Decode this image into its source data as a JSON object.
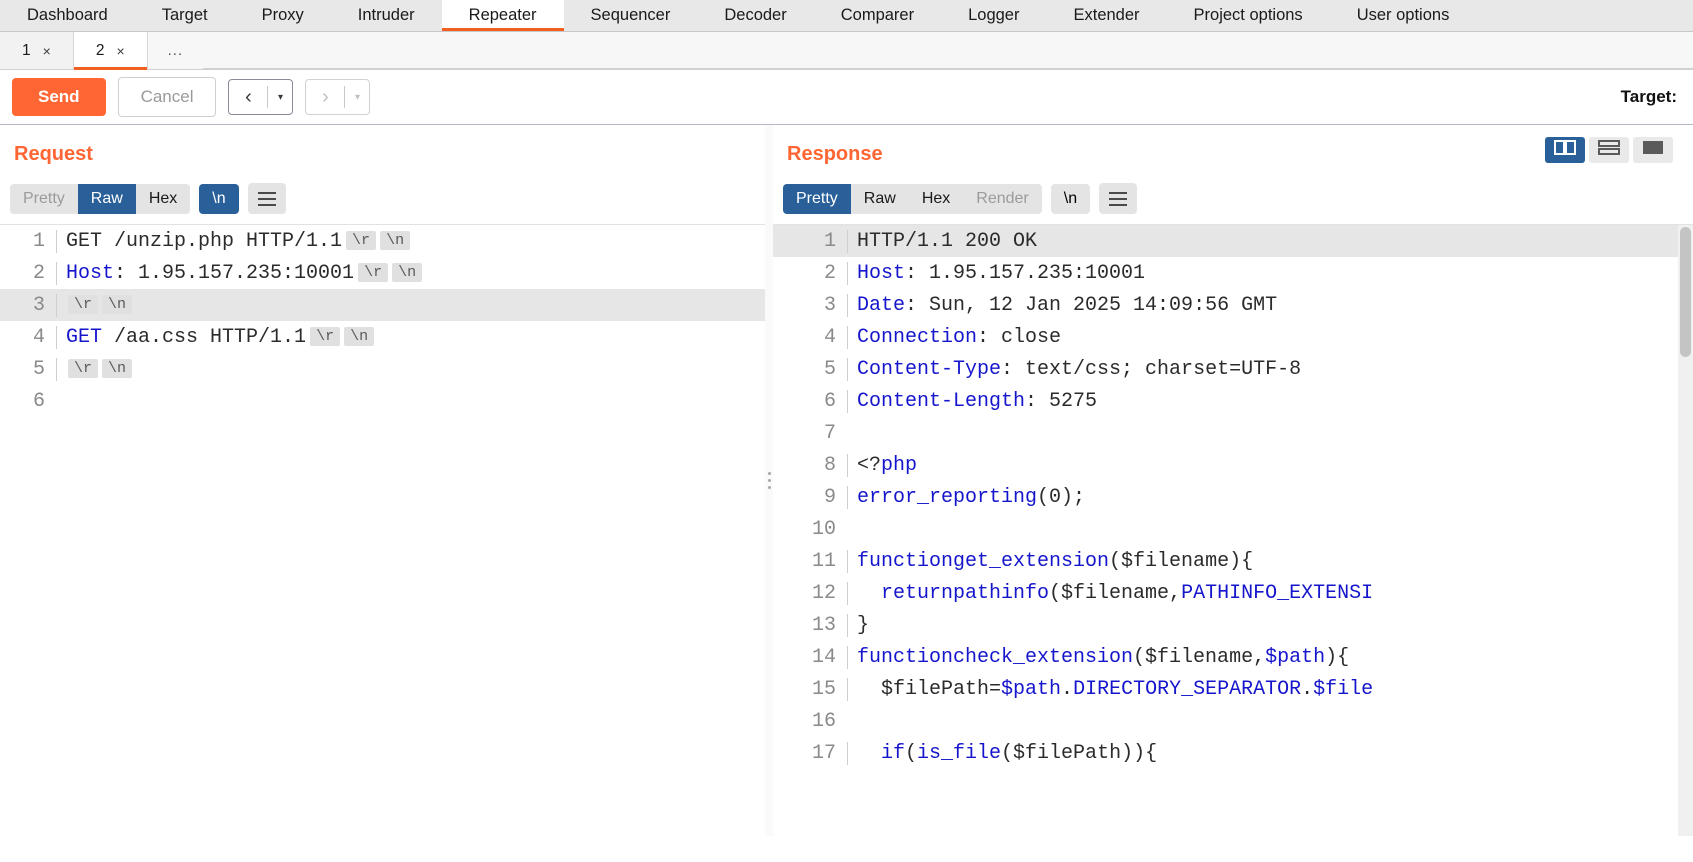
{
  "top_tabs": [
    {
      "label": "Dashboard",
      "active": false
    },
    {
      "label": "Target",
      "active": false
    },
    {
      "label": "Proxy",
      "active": false
    },
    {
      "label": "Intruder",
      "active": false
    },
    {
      "label": "Repeater",
      "active": true
    },
    {
      "label": "Sequencer",
      "active": false
    },
    {
      "label": "Decoder",
      "active": false
    },
    {
      "label": "Comparer",
      "active": false
    },
    {
      "label": "Logger",
      "active": false
    },
    {
      "label": "Extender",
      "active": false
    },
    {
      "label": "Project options",
      "active": false
    },
    {
      "label": "User options",
      "active": false
    }
  ],
  "sub_tabs": [
    {
      "label": "1",
      "close": "×",
      "active": false
    },
    {
      "label": "2",
      "close": "×",
      "active": true
    }
  ],
  "sub_tabs_more": "...",
  "toolbar": {
    "send_label": "Send",
    "cancel_label": "Cancel",
    "back_arrow": "‹",
    "forward_arrow": "›",
    "caret": "▾",
    "target_label": "Target:"
  },
  "accent_color": "#ff6633",
  "select_color": "#2a6099",
  "request": {
    "title": "Request",
    "tabs": [
      {
        "label": "Pretty",
        "state": "dim"
      },
      {
        "label": "Raw",
        "state": "active"
      },
      {
        "label": "Hex",
        "state": "normal"
      }
    ],
    "newline_toggle": "\\n",
    "menu_icon": "hamburger-icon",
    "lines": [
      {
        "n": "1",
        "highlight": false,
        "parts": [
          {
            "t": "GET /unzip.php HTTP/1.1",
            "c": "dark"
          }
        ],
        "crlf": [
          "\\r",
          "\\n"
        ]
      },
      {
        "n": "2",
        "highlight": false,
        "parts": [
          {
            "t": "Host",
            "c": "blue"
          },
          {
            "t": ": 1.95.157.235:10001",
            "c": "dark"
          }
        ],
        "crlf": [
          "\\r",
          "\\n"
        ]
      },
      {
        "n": "3",
        "highlight": true,
        "parts": [],
        "crlf": [
          "\\r",
          "\\n"
        ]
      },
      {
        "n": "4",
        "highlight": false,
        "parts": [
          {
            "t": "GET",
            "c": "blue"
          },
          {
            "t": " /aa.css HTTP/1.1",
            "c": "dark"
          }
        ],
        "crlf": [
          "\\r",
          "\\n"
        ]
      },
      {
        "n": "5",
        "highlight": false,
        "parts": [],
        "crlf": [
          "\\r",
          "\\n"
        ]
      },
      {
        "n": "6",
        "highlight": false,
        "parts": [],
        "crlf": []
      }
    ]
  },
  "response": {
    "title": "Response",
    "tabs": [
      {
        "label": "Pretty",
        "state": "active"
      },
      {
        "label": "Raw",
        "state": "normal"
      },
      {
        "label": "Hex",
        "state": "normal"
      },
      {
        "label": "Render",
        "state": "dim"
      }
    ],
    "newline_toggle": "\\n",
    "menu_icon": "hamburger-icon",
    "layout_toggles": [
      {
        "name": "split-vertical-view",
        "active": true
      },
      {
        "name": "split-horizontal-view",
        "active": false
      },
      {
        "name": "single-pane-view",
        "active": false
      }
    ],
    "lines": [
      {
        "n": "1",
        "highlight": true,
        "parts": [
          {
            "t": "HTTP/1.1 200 OK",
            "c": "dark"
          }
        ]
      },
      {
        "n": "2",
        "highlight": false,
        "parts": [
          {
            "t": "Host",
            "c": "blue"
          },
          {
            "t": ": 1.95.157.235:10001",
            "c": "dark"
          }
        ]
      },
      {
        "n": "3",
        "highlight": false,
        "parts": [
          {
            "t": "Date",
            "c": "blue"
          },
          {
            "t": ": Sun, 12 Jan 2025 14:09:56 GMT",
            "c": "dark"
          }
        ]
      },
      {
        "n": "4",
        "highlight": false,
        "parts": [
          {
            "t": "Connection",
            "c": "blue"
          },
          {
            "t": ": close",
            "c": "dark"
          }
        ]
      },
      {
        "n": "5",
        "highlight": false,
        "parts": [
          {
            "t": "Content-Type",
            "c": "blue"
          },
          {
            "t": ": text/css; charset=UTF-8",
            "c": "dark"
          }
        ]
      },
      {
        "n": "6",
        "highlight": false,
        "parts": [
          {
            "t": "Content-Length",
            "c": "blue"
          },
          {
            "t": ": 5275",
            "c": "dark"
          }
        ]
      },
      {
        "n": "7",
        "highlight": false,
        "parts": []
      },
      {
        "n": "8",
        "highlight": false,
        "parts": [
          {
            "t": "<?",
            "c": "dark"
          },
          {
            "t": "php",
            "c": "blue"
          }
        ]
      },
      {
        "n": "9",
        "highlight": false,
        "parts": [
          {
            "t": "error_reporting",
            "c": "blue"
          },
          {
            "t": "(0);",
            "c": "dark"
          }
        ]
      },
      {
        "n": "10",
        "highlight": false,
        "parts": []
      },
      {
        "n": "11",
        "highlight": false,
        "parts": [
          {
            "t": "function",
            "c": "blue"
          },
          {
            "t": "get_extension",
            "c": "blue"
          },
          {
            "t": "($filename){",
            "c": "dark"
          }
        ]
      },
      {
        "n": "12",
        "highlight": false,
        "parts": [
          {
            "t": "  return",
            "c": "blue"
          },
          {
            "t": "pathinfo",
            "c": "blue"
          },
          {
            "t": "($filename,",
            "c": "dark"
          },
          {
            "t": "PATHINFO_EXTENSI",
            "c": "blue"
          }
        ]
      },
      {
        "n": "13",
        "highlight": false,
        "parts": [
          {
            "t": "}",
            "c": "dark"
          }
        ]
      },
      {
        "n": "14",
        "highlight": false,
        "parts": [
          {
            "t": "function",
            "c": "blue"
          },
          {
            "t": "check_extension",
            "c": "blue"
          },
          {
            "t": "($filename,",
            "c": "dark"
          },
          {
            "t": "$path",
            "c": "blue"
          },
          {
            "t": "){",
            "c": "dark"
          }
        ]
      },
      {
        "n": "15",
        "highlight": false,
        "parts": [
          {
            "t": "  $filePath=",
            "c": "dark"
          },
          {
            "t": "$path",
            "c": "blue"
          },
          {
            "t": ".",
            "c": "dark"
          },
          {
            "t": "DIRECTORY_SEPARATOR",
            "c": "blue"
          },
          {
            "t": ".",
            "c": "dark"
          },
          {
            "t": "$file",
            "c": "blue"
          }
        ]
      },
      {
        "n": "16",
        "highlight": false,
        "parts": []
      },
      {
        "n": "17",
        "highlight": false,
        "parts": [
          {
            "t": "  if",
            "c": "blue"
          },
          {
            "t": "(",
            "c": "dark"
          },
          {
            "t": "is_file",
            "c": "blue"
          },
          {
            "t": "($filePath)){",
            "c": "dark"
          }
        ]
      }
    ]
  }
}
